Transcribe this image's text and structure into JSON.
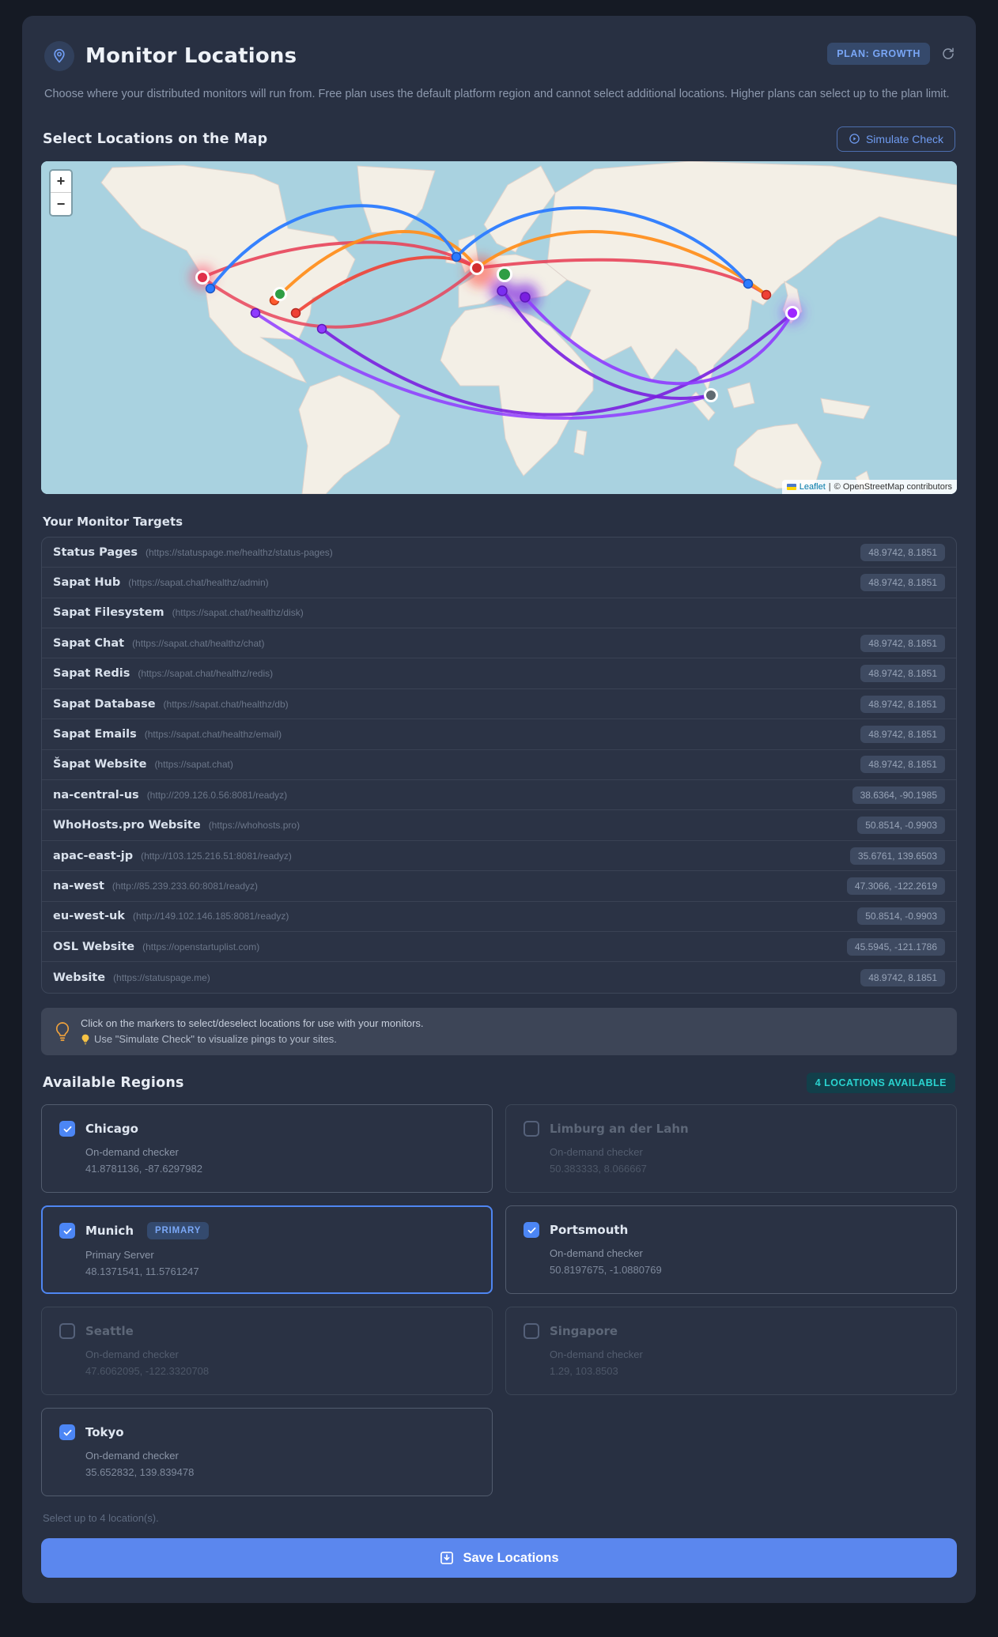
{
  "header": {
    "title": "Monitor Locations",
    "plan_badge": "PLAN: GROWTH",
    "description": "Choose where your distributed monitors will run from. Free plan uses the default platform region and cannot select additional locations. Higher plans can select up to the plan limit."
  },
  "map_section": {
    "heading": "Select Locations on the Map",
    "simulate_button": "Simulate Check",
    "zoom_in": "+",
    "zoom_out": "−",
    "attribution": {
      "leaflet": "Leaflet",
      "separator": "|",
      "osm": "© OpenStreetMap contributors"
    }
  },
  "targets": {
    "heading": "Your Monitor Targets",
    "items": [
      {
        "name": "Status Pages",
        "url": "(https://statuspage.me/healthz/status-pages)",
        "coords": "48.9742, 8.1851"
      },
      {
        "name": "Sapat Hub",
        "url": "(https://sapat.chat/healthz/admin)",
        "coords": "48.9742, 8.1851"
      },
      {
        "name": "Sapat Filesystem",
        "url": "(https://sapat.chat/healthz/disk)",
        "coords": ""
      },
      {
        "name": "Sapat Chat",
        "url": "(https://sapat.chat/healthz/chat)",
        "coords": "48.9742, 8.1851"
      },
      {
        "name": "Sapat Redis",
        "url": "(https://sapat.chat/healthz/redis)",
        "coords": "48.9742, 8.1851"
      },
      {
        "name": "Sapat Database",
        "url": "(https://sapat.chat/healthz/db)",
        "coords": "48.9742, 8.1851"
      },
      {
        "name": "Sapat Emails",
        "url": "(https://sapat.chat/healthz/email)",
        "coords": "48.9742, 8.1851"
      },
      {
        "name": "Šapat Website",
        "url": "(https://sapat.chat)",
        "coords": "48.9742, 8.1851"
      },
      {
        "name": "na-central-us",
        "url": "(http://209.126.0.56:8081/readyz)",
        "coords": "38.6364, -90.1985"
      },
      {
        "name": "WhoHosts.pro Website",
        "url": "(https://whohosts.pro)",
        "coords": "50.8514, -0.9903"
      },
      {
        "name": "apac-east-jp",
        "url": "(http://103.125.216.51:8081/readyz)",
        "coords": "35.6761, 139.6503"
      },
      {
        "name": "na-west",
        "url": "(http://85.239.233.60:8081/readyz)",
        "coords": "47.3066, -122.2619"
      },
      {
        "name": "eu-west-uk",
        "url": "(http://149.102.146.185:8081/readyz)",
        "coords": "50.8514, -0.9903"
      },
      {
        "name": "OSL Website",
        "url": "(https://openstartuplist.com)",
        "coords": "45.5945, -121.1786"
      },
      {
        "name": "Website",
        "url": "(https://statuspage.me)",
        "coords": "48.9742, 8.1851"
      }
    ]
  },
  "tip": {
    "line1": "Click on the markers to select/deselect locations for use with your monitors.",
    "line2": "Use \"Simulate Check\" to visualize pings to your sites."
  },
  "regions": {
    "heading": "Available Regions",
    "badge": "4 LOCATIONS AVAILABLE",
    "footnote": "Select up to 4 location(s).",
    "cards": [
      {
        "name": "Chicago",
        "desc": "On-demand checker",
        "coords": "41.8781136, -87.6297982",
        "checked": true,
        "dimmed": false,
        "primary": false
      },
      {
        "name": "Limburg an der Lahn",
        "desc": "On-demand checker",
        "coords": "50.383333, 8.066667",
        "checked": false,
        "dimmed": true,
        "primary": false
      },
      {
        "name": "Munich",
        "badge": "PRIMARY",
        "desc": "Primary Server",
        "coords": "48.1371541, 11.5761247",
        "checked": true,
        "dimmed": false,
        "primary": true
      },
      {
        "name": "Portsmouth",
        "desc": "On-demand checker",
        "coords": "50.8197675, -1.0880769",
        "checked": true,
        "dimmed": false,
        "primary": false
      },
      {
        "name": "Seattle",
        "desc": "On-demand checker",
        "coords": "47.6062095, -122.3320708",
        "checked": false,
        "dimmed": true,
        "primary": false
      },
      {
        "name": "Singapore",
        "desc": "On-demand checker",
        "coords": "1.29, 103.8503",
        "checked": false,
        "dimmed": true,
        "primary": false
      },
      {
        "name": "Tokyo",
        "desc": "On-demand checker",
        "coords": "35.652832, 139.839478",
        "checked": true,
        "dimmed": false,
        "primary": false
      }
    ]
  },
  "save_button": "Save Locations",
  "colors": {
    "accent_blue": "#4c86f5",
    "plan_badge_text": "#79a6f6",
    "available_badge_text": "#2ad3cf",
    "map_water": "#a9d2e0",
    "map_land": "#f3efe6",
    "ping_blue": "#2b7bff",
    "ping_orange": "#ff8f1f",
    "ping_red": "#e8445a",
    "ping_purple": "#7a1fe0"
  }
}
